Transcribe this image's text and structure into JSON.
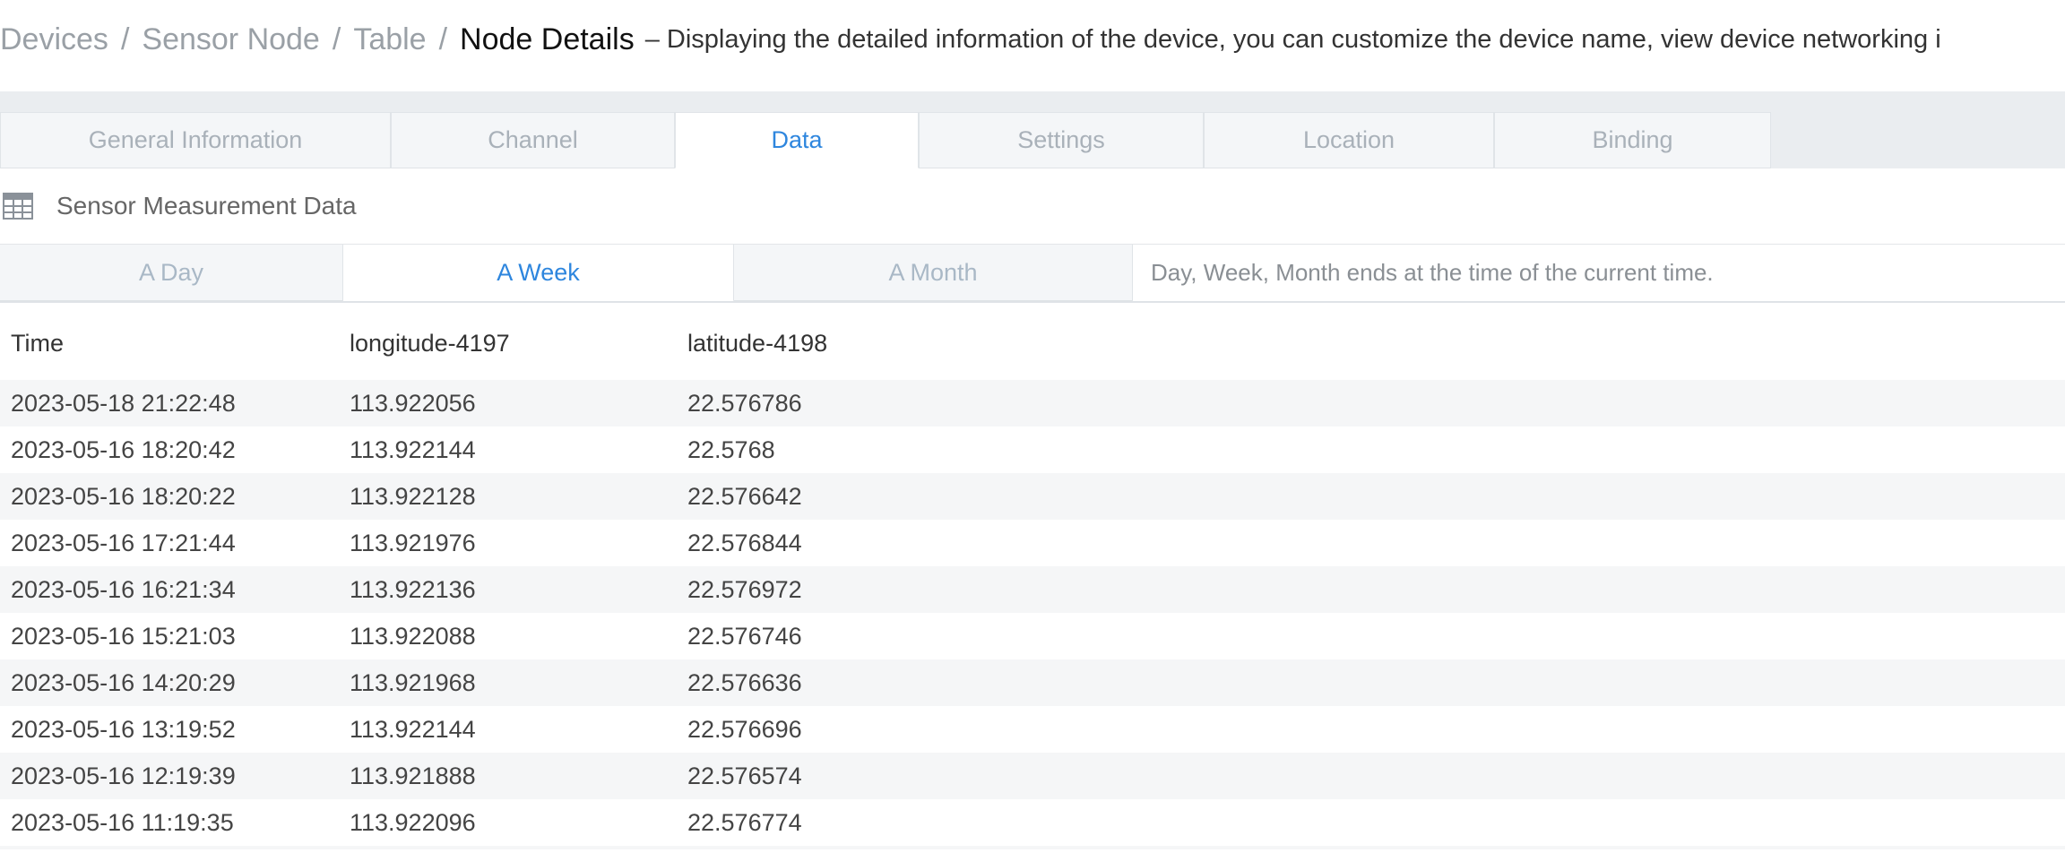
{
  "breadcrumb": {
    "items": [
      "Devices",
      "Sensor Node",
      "Table"
    ],
    "separator": "/",
    "current": "Node Details",
    "description": "– Displaying the detailed information of the device, you can customize the device name, view device networking i"
  },
  "tabs": [
    {
      "label": "General Information",
      "active": false
    },
    {
      "label": "Channel",
      "active": false
    },
    {
      "label": "Data",
      "active": true
    },
    {
      "label": "Settings",
      "active": false
    },
    {
      "label": "Location",
      "active": false
    },
    {
      "label": "Binding",
      "active": false
    }
  ],
  "section": {
    "title": "Sensor Measurement Data",
    "icon": "table-icon"
  },
  "range_tabs": [
    {
      "label": "A Day",
      "active": false
    },
    {
      "label": "A Week",
      "active": true
    },
    {
      "label": "A Month",
      "active": false
    }
  ],
  "range_note": "Day, Week, Month ends at the time of the current time.",
  "table": {
    "headers": [
      "Time",
      "longitude-4197",
      "latitude-4198"
    ],
    "rows": [
      [
        "2023-05-18 21:22:48",
        "113.922056",
        "22.576786"
      ],
      [
        "2023-05-16 18:20:42",
        "113.922144",
        "22.5768"
      ],
      [
        "2023-05-16 18:20:22",
        "113.922128",
        "22.576642"
      ],
      [
        "2023-05-16 17:21:44",
        "113.921976",
        "22.576844"
      ],
      [
        "2023-05-16 16:21:34",
        "113.922136",
        "22.576972"
      ],
      [
        "2023-05-16 15:21:03",
        "113.922088",
        "22.576746"
      ],
      [
        "2023-05-16 14:20:29",
        "113.921968",
        "22.576636"
      ],
      [
        "2023-05-16 13:19:52",
        "113.922144",
        "22.576696"
      ],
      [
        "2023-05-16 12:19:39",
        "113.921888",
        "22.576574"
      ],
      [
        "2023-05-16 11:19:35",
        "113.922096",
        "22.576774"
      ]
    ]
  },
  "colors": {
    "accent": "#2e86de",
    "tab_inactive_text": "#a9b1b9",
    "band": "#eaedf0",
    "row_stripe": "#f5f6f7"
  }
}
